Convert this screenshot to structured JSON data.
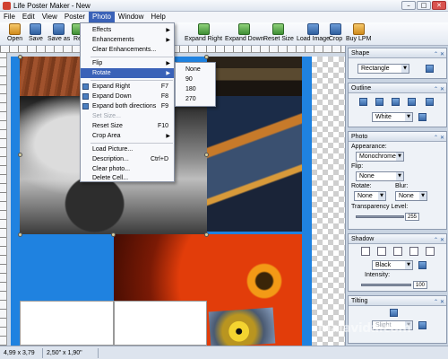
{
  "window": {
    "title": "Life Poster Maker - New",
    "buttons": [
      "–",
      "□",
      "✕"
    ]
  },
  "menubar": {
    "items": [
      "File",
      "Edit",
      "View",
      "Poster",
      "Photo",
      "Window",
      "Help"
    ],
    "active": "Photo"
  },
  "toolbar": {
    "items": [
      {
        "label": "Open",
        "icon": "folder-icon"
      },
      {
        "label": "Save",
        "icon": "disk-icon"
      },
      {
        "label": "Save as",
        "icon": "disk-as-icon"
      },
      {
        "label": "Re",
        "icon": "redo-icon"
      },
      {
        "label": "Expand Right",
        "icon": "expand-right-icon"
      },
      {
        "label": "Expand Down",
        "icon": "expand-down-icon"
      },
      {
        "label": "Reset Size",
        "icon": "reset-size-icon"
      },
      {
        "label": "Load Image",
        "icon": "load-image-icon"
      },
      {
        "label": "Crop",
        "icon": "crop-icon"
      },
      {
        "label": "Buy LPM",
        "icon": "buy-icon"
      }
    ]
  },
  "photo_menu": {
    "items": [
      {
        "label": "Effects",
        "shortcut": "",
        "submenu": true
      },
      {
        "label": "Enhancements",
        "shortcut": "",
        "submenu": true
      },
      {
        "label": "Clear Enhancements...",
        "shortcut": ""
      },
      {
        "label": "Flip",
        "shortcut": "",
        "submenu": true
      },
      {
        "label": "Rotate",
        "shortcut": "",
        "submenu": true,
        "selected": true
      },
      {
        "label": "Expand Right",
        "shortcut": "F7",
        "icon": true
      },
      {
        "label": "Expand Down",
        "shortcut": "F8",
        "icon": true
      },
      {
        "label": "Expand both directions",
        "shortcut": "F9",
        "icon": true
      },
      {
        "label": "Set Size...",
        "shortcut": "",
        "disabled": true
      },
      {
        "label": "Reset Size",
        "shortcut": "F10"
      },
      {
        "label": "Crop Area",
        "shortcut": "",
        "submenu": true
      },
      {
        "label": "Load Picture...",
        "shortcut": ""
      },
      {
        "label": "Description...",
        "shortcut": "Ctrl+D"
      },
      {
        "label": "Clear photo...",
        "shortcut": ""
      },
      {
        "label": "Delete Cell...",
        "shortcut": ""
      }
    ]
  },
  "rotate_submenu": {
    "items": [
      "None",
      "90",
      "180",
      "270"
    ]
  },
  "panel": {
    "shape": {
      "title": "Shape",
      "value": "Rectangle"
    },
    "outline": {
      "title": "Outline",
      "color": "White"
    },
    "photo": {
      "title": "Photo",
      "appearance_label": "Appearance:",
      "appearance": "Monochrome",
      "flip_label": "Flip:",
      "flip": "None",
      "rotate_label": "Rotate:",
      "rotate": "None",
      "blur_label": "Blur:",
      "blur": "None",
      "transparency_label": "Transparency Level:",
      "transparency": "255"
    },
    "shadow": {
      "title": "Shadow",
      "color": "Black",
      "intensity_label": "Intensity:",
      "intensity": "100"
    },
    "tilting": {
      "title": "Tilting",
      "value": "Slight"
    }
  },
  "status": {
    "size": "4,99 x 3,79",
    "cell": "2,50\" x 1,90\""
  },
  "watermark": "malavida.com",
  "colors": {
    "poster_bg": "#1f82e0",
    "menu_highlight": "#3a62b8"
  }
}
